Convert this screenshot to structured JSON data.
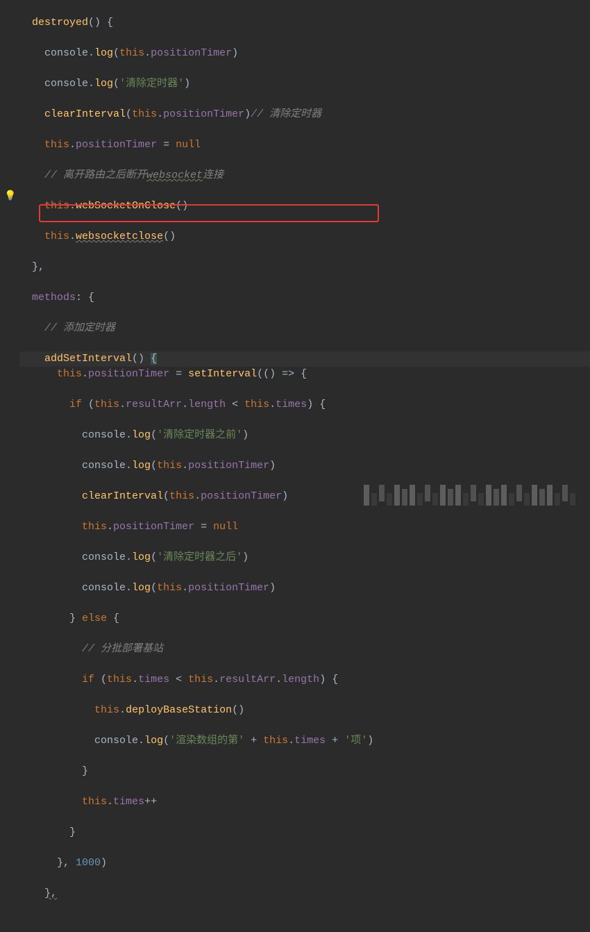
{
  "code": {
    "l1a": "destroyed",
    "l1b": "() {",
    "l2a": "console",
    "l2b": ".",
    "l2c": "log",
    "l2d": "(",
    "l2e": "this",
    "l2f": ".",
    "l2g": "positionTimer",
    "l2h": ")",
    "l3a": "console",
    "l3b": ".",
    "l3c": "log",
    "l3d": "(",
    "l3e": "'清除定时器'",
    "l3f": ")",
    "l4a": "clearInterval",
    "l4b": "(",
    "l4c": "this",
    "l4d": ".",
    "l4e": "positionTimer",
    "l4f": ")",
    "l4g": "// 清除定时器",
    "l5a": "this",
    "l5b": ".",
    "l5c": "positionTimer",
    "l5d": " = ",
    "l5e": "null",
    "l6a": "// 离开路由之后断开",
    "l6b": "websocket",
    "l6c": "连接",
    "l7a": "this",
    "l7b": ".",
    "l7c": "webSocketOnClose",
    "l7d": "()",
    "l8a": "this",
    "l8b": ".",
    "l8c": "websocketclose",
    "l8d": "()",
    "l9a": "},",
    "l10a": "methods",
    "l10b": ": {",
    "l11a": "// 添加定时器",
    "l12a": "addSetInterval",
    "l12b": "() ",
    "l12c": "{",
    "l13a": "this",
    "l13b": ".",
    "l13c": "positionTimer",
    "l13d": " = ",
    "l13e": "setInterval",
    "l13f": "(() => {",
    "l14a": "if",
    "l14b": " (",
    "l14c": "this",
    "l14d": ".",
    "l14e": "resultArr",
    "l14f": ".",
    "l14g": "length",
    "l14h": " < ",
    "l14i": "this",
    "l14j": ".",
    "l14k": "times",
    "l14l": ") {",
    "l15a": "console",
    "l15b": ".",
    "l15c": "log",
    "l15d": "(",
    "l15e": "'清除定时器之前'",
    "l15f": ")",
    "l16a": "console",
    "l16b": ".",
    "l16c": "log",
    "l16d": "(",
    "l16e": "this",
    "l16f": ".",
    "l16g": "positionTimer",
    "l16h": ")",
    "l17a": "clearInterval",
    "l17b": "(",
    "l17c": "this",
    "l17d": ".",
    "l17e": "positionTimer",
    "l17f": ")",
    "l18a": "this",
    "l18b": ".",
    "l18c": "positionTimer",
    "l18d": " = ",
    "l18e": "null",
    "l19a": "console",
    "l19b": ".",
    "l19c": "log",
    "l19d": "(",
    "l19e": "'清除定时器之后'",
    "l19f": ")",
    "l20a": "console",
    "l20b": ".",
    "l20c": "log",
    "l20d": "(",
    "l20e": "this",
    "l20f": ".",
    "l20g": "positionTimer",
    "l20h": ")",
    "l21a": "} ",
    "l21b": "else",
    "l21c": " {",
    "l22a": "// 分批部署基站",
    "l23a": "if",
    "l23b": " (",
    "l23c": "this",
    "l23d": ".",
    "l23e": "times",
    "l23f": " < ",
    "l23g": "this",
    "l23h": ".",
    "l23i": "resultArr",
    "l23j": ".",
    "l23k": "length",
    "l23l": ") {",
    "l24a": "this",
    "l24b": ".",
    "l24c": "deployBaseStation",
    "l24d": "()",
    "l25a": "console",
    "l25b": ".",
    "l25c": "log",
    "l25d": "(",
    "l25e": "'渲染数组的第'",
    "l25f": " + ",
    "l25g": "this",
    "l25h": ".",
    "l25i": "times",
    "l25j": " + ",
    "l25k": "'项'",
    "l25l": ")",
    "l26a": "}",
    "l27a": "this",
    "l27b": ".",
    "l27c": "times",
    "l27d": "++",
    "l28a": "}",
    "l29a": "}, ",
    "l29b": "1000",
    "l29c": ")",
    "l30a": "},"
  },
  "indent": {
    "i1": "  ",
    "i2": "    ",
    "i3": "      ",
    "i4": "        ",
    "i5": "          ",
    "i6": "            "
  }
}
